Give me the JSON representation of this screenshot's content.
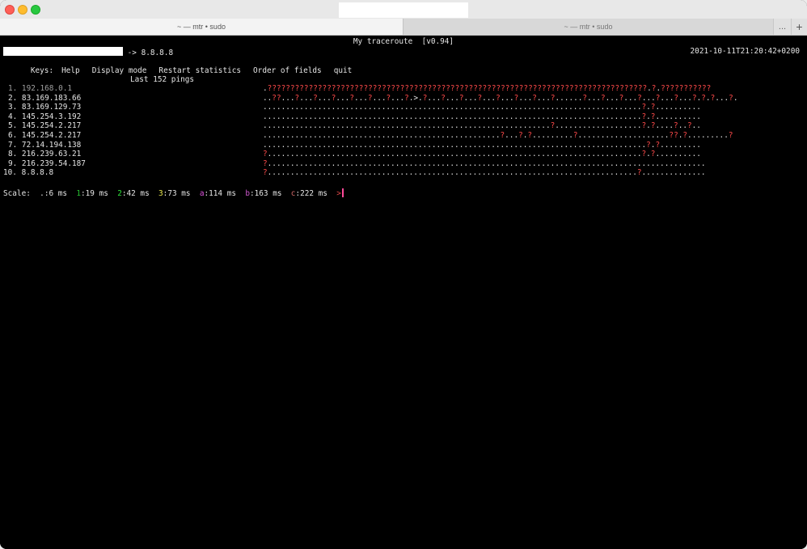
{
  "window": {
    "tabs": [
      {
        "label": "~ — mtr • sudo",
        "active": true
      },
      {
        "label": "~ — mtr • sudo",
        "active": false
      }
    ],
    "tab_more_label": "...",
    "tab_add_label": "+"
  },
  "mtr": {
    "title": "My traceroute  [v0.94]",
    "target": "-> 8.8.8.8",
    "datetime": "2021-10-11T21:20:42+0200",
    "keys_label": "Keys:",
    "keys": [
      "Help",
      "Display mode",
      "Restart statistics",
      "Order of fields",
      "quit"
    ],
    "pings_header": "Last 152 pings",
    "hops": [
      {
        "label": "1. 192.168.0.1",
        "pattern": ".???????????????????????????????????????????????????????????????????????????????????.?.???????????"
      },
      {
        "label": "2. 83.169.183.66",
        "pattern": "..??...?...?...?...?...?...?...?.>.?...?...?...?...?...?...?...?......?...?...?...?...?...?...?.?.?...?."
      },
      {
        "label": "3. 83.169.129.73",
        "pattern": "...................................................................................?.?.........."
      },
      {
        "label": "4. 145.254.3.192",
        "pattern": "...................................................................................?.?.........."
      },
      {
        "label": "5. 145.254.2.217",
        "pattern": "...............................................................?...................?.?....?..?.."
      },
      {
        "label": "6. 145.254.2.217",
        "pattern": "....................................................?...?.?.........?....................??.?.........?"
      },
      {
        "label": "7. 72.14.194.138",
        "pattern": "....................................................................................?.?........."
      },
      {
        "label": "8. 216.239.63.21",
        "pattern": "?..................................................................................?.?.........."
      },
      {
        "label": "9. 216.239.54.187",
        "pattern": "?................................................................................................"
      },
      {
        "label": "10. 8.8.8.8",
        "pattern": "?.................................................................................?.............."
      }
    ],
    "scale_label": "Scale:",
    "scale": [
      {
        "sym": ".",
        "text": ":6 ms"
      },
      {
        "sym": "1",
        "text": ":19 ms"
      },
      {
        "sym": "2",
        "text": ":42 ms"
      },
      {
        "sym": "3",
        "text": ":73 ms"
      },
      {
        "sym": "a",
        "text": ":114 ms"
      },
      {
        "sym": "b",
        "text": ":163 ms"
      },
      {
        "sym": "c",
        "text": ":222 ms"
      },
      {
        "sym": ">",
        "text": ""
      }
    ]
  },
  "colors": {
    "loss": "#ff4a4a",
    "scale_1": "#27c232",
    "scale_2": "#2fe03b",
    "scale_3": "#e9e84e",
    "scale_a": "#e055e0",
    "scale_b": "#d15ad1",
    "scale_c": "#d46a6a",
    "scale_gt": "#e04848"
  }
}
